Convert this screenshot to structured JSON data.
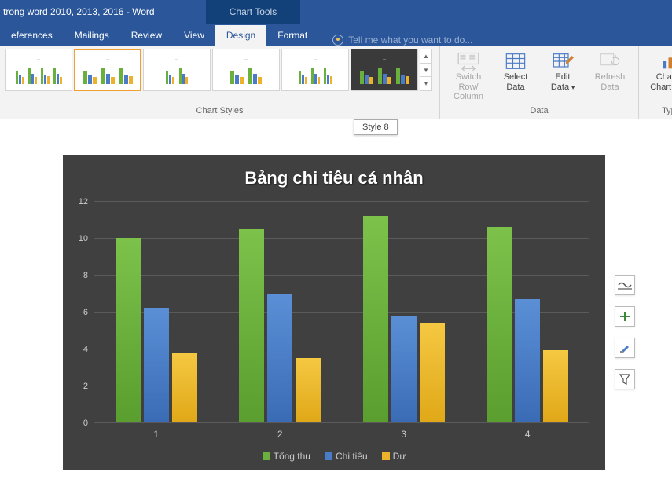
{
  "titlebar": {
    "doc_title": " trong word 2010, 2013, 2016 - Word",
    "chart_tools": "Chart Tools"
  },
  "menubar": {
    "tabs": [
      "eferences",
      "Mailings",
      "Review",
      "View",
      "Design",
      "Format"
    ],
    "active_index": 4,
    "tellme_placeholder": "Tell me what you want to do..."
  },
  "ribbon": {
    "chart_styles_label": "Chart Styles",
    "data_label": "Data",
    "type_label": "Type",
    "buttons": {
      "switch": "Switch Row/\nColumn",
      "select": "Select\nData",
      "edit": "Edit\nData",
      "refresh": "Refresh\nData",
      "change": "Change\nChart Type"
    }
  },
  "tooltip": "Style 8",
  "chart_data": {
    "type": "bar",
    "title": "Bảng chi tiêu cá nhân",
    "categories": [
      "1",
      "2",
      "3",
      "4"
    ],
    "series": [
      {
        "name": "Tổng thu",
        "color": "#6ab03c",
        "values": [
          10.0,
          10.5,
          11.2,
          10.6
        ]
      },
      {
        "name": "Chi tiêu",
        "color": "#4a7bc8",
        "values": [
          6.2,
          7.0,
          5.8,
          6.7
        ]
      },
      {
        "name": "Dư",
        "color": "#eeb22a",
        "values": [
          3.8,
          3.5,
          5.4,
          3.9
        ]
      }
    ],
    "ylim": [
      0,
      12
    ],
    "ytick": 2,
    "xlabel": "",
    "ylabel": ""
  }
}
